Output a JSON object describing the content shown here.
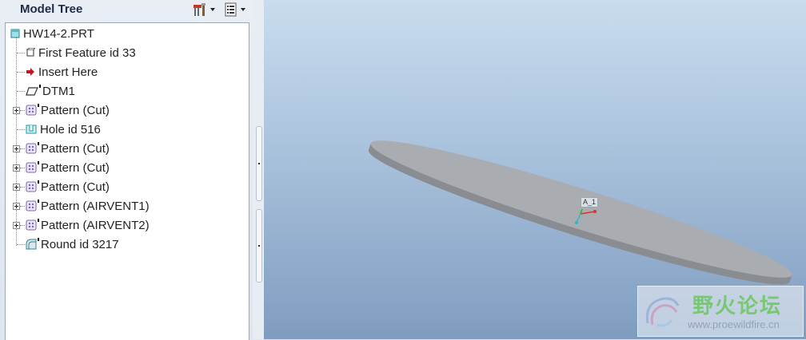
{
  "panel": {
    "title": "Model Tree",
    "settings_icon": "tree-settings-icon",
    "columns_icon": "tree-columns-icon"
  },
  "tree": {
    "root": {
      "label": "HW14-2.PRT",
      "icon": "part-icon"
    },
    "items": [
      {
        "label": "First Feature id 33",
        "icon": "feature-box-icon",
        "expandable": false
      },
      {
        "label": "Insert Here",
        "icon": "insert-arrow-icon",
        "expandable": false
      },
      {
        "label": "DTM1",
        "icon": "datum-plane-icon",
        "expandable": false
      },
      {
        "label": "Pattern (Cut)",
        "icon": "pattern-icon",
        "expandable": true
      },
      {
        "label": "Hole id 516",
        "icon": "hole-icon",
        "expandable": false
      },
      {
        "label": "Pattern (Cut)",
        "icon": "pattern-icon",
        "expandable": true
      },
      {
        "label": "Pattern (Cut)",
        "icon": "pattern-icon",
        "expandable": true
      },
      {
        "label": "Pattern (Cut)",
        "icon": "pattern-icon",
        "expandable": true
      },
      {
        "label": "Pattern (AIRVENT1)",
        "icon": "pattern-icon",
        "expandable": true
      },
      {
        "label": "Pattern (AIRVENT2)",
        "icon": "pattern-icon",
        "expandable": true
      },
      {
        "label": "Round id 3217",
        "icon": "round-icon",
        "expandable": false
      }
    ]
  },
  "viewport": {
    "csys_label": "A_1",
    "watermark_cn": "野火论坛",
    "watermark_url": "www.proewildfire.cn"
  },
  "colors": {
    "background_top": "#c9dcee",
    "background_bottom": "#7f9cc0",
    "part_surface": "#a9adb2",
    "part_edge": "#8a8e93"
  }
}
